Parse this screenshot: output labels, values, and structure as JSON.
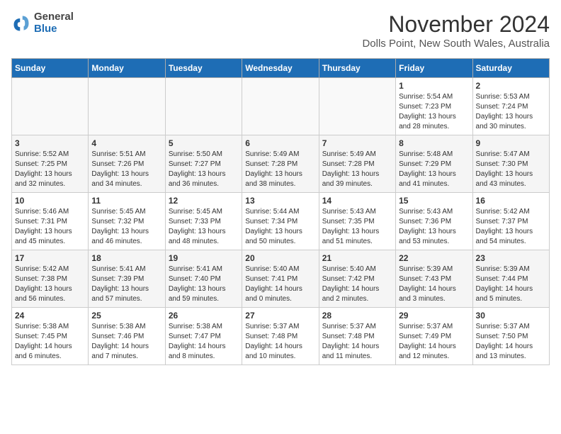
{
  "header": {
    "logo": {
      "line1": "General",
      "line2": "Blue"
    },
    "title": "November 2024",
    "subtitle": "Dolls Point, New South Wales, Australia"
  },
  "weekdays": [
    "Sunday",
    "Monday",
    "Tuesday",
    "Wednesday",
    "Thursday",
    "Friday",
    "Saturday"
  ],
  "weeks": [
    [
      {
        "day": "",
        "info": ""
      },
      {
        "day": "",
        "info": ""
      },
      {
        "day": "",
        "info": ""
      },
      {
        "day": "",
        "info": ""
      },
      {
        "day": "",
        "info": ""
      },
      {
        "day": "1",
        "info": "Sunrise: 5:54 AM\nSunset: 7:23 PM\nDaylight: 13 hours and 28 minutes."
      },
      {
        "day": "2",
        "info": "Sunrise: 5:53 AM\nSunset: 7:24 PM\nDaylight: 13 hours and 30 minutes."
      }
    ],
    [
      {
        "day": "3",
        "info": "Sunrise: 5:52 AM\nSunset: 7:25 PM\nDaylight: 13 hours and 32 minutes."
      },
      {
        "day": "4",
        "info": "Sunrise: 5:51 AM\nSunset: 7:26 PM\nDaylight: 13 hours and 34 minutes."
      },
      {
        "day": "5",
        "info": "Sunrise: 5:50 AM\nSunset: 7:27 PM\nDaylight: 13 hours and 36 minutes."
      },
      {
        "day": "6",
        "info": "Sunrise: 5:49 AM\nSunset: 7:28 PM\nDaylight: 13 hours and 38 minutes."
      },
      {
        "day": "7",
        "info": "Sunrise: 5:49 AM\nSunset: 7:28 PM\nDaylight: 13 hours and 39 minutes."
      },
      {
        "day": "8",
        "info": "Sunrise: 5:48 AM\nSunset: 7:29 PM\nDaylight: 13 hours and 41 minutes."
      },
      {
        "day": "9",
        "info": "Sunrise: 5:47 AM\nSunset: 7:30 PM\nDaylight: 13 hours and 43 minutes."
      }
    ],
    [
      {
        "day": "10",
        "info": "Sunrise: 5:46 AM\nSunset: 7:31 PM\nDaylight: 13 hours and 45 minutes."
      },
      {
        "day": "11",
        "info": "Sunrise: 5:45 AM\nSunset: 7:32 PM\nDaylight: 13 hours and 46 minutes."
      },
      {
        "day": "12",
        "info": "Sunrise: 5:45 AM\nSunset: 7:33 PM\nDaylight: 13 hours and 48 minutes."
      },
      {
        "day": "13",
        "info": "Sunrise: 5:44 AM\nSunset: 7:34 PM\nDaylight: 13 hours and 50 minutes."
      },
      {
        "day": "14",
        "info": "Sunrise: 5:43 AM\nSunset: 7:35 PM\nDaylight: 13 hours and 51 minutes."
      },
      {
        "day": "15",
        "info": "Sunrise: 5:43 AM\nSunset: 7:36 PM\nDaylight: 13 hours and 53 minutes."
      },
      {
        "day": "16",
        "info": "Sunrise: 5:42 AM\nSunset: 7:37 PM\nDaylight: 13 hours and 54 minutes."
      }
    ],
    [
      {
        "day": "17",
        "info": "Sunrise: 5:42 AM\nSunset: 7:38 PM\nDaylight: 13 hours and 56 minutes."
      },
      {
        "day": "18",
        "info": "Sunrise: 5:41 AM\nSunset: 7:39 PM\nDaylight: 13 hours and 57 minutes."
      },
      {
        "day": "19",
        "info": "Sunrise: 5:41 AM\nSunset: 7:40 PM\nDaylight: 13 hours and 59 minutes."
      },
      {
        "day": "20",
        "info": "Sunrise: 5:40 AM\nSunset: 7:41 PM\nDaylight: 14 hours and 0 minutes."
      },
      {
        "day": "21",
        "info": "Sunrise: 5:40 AM\nSunset: 7:42 PM\nDaylight: 14 hours and 2 minutes."
      },
      {
        "day": "22",
        "info": "Sunrise: 5:39 AM\nSunset: 7:43 PM\nDaylight: 14 hours and 3 minutes."
      },
      {
        "day": "23",
        "info": "Sunrise: 5:39 AM\nSunset: 7:44 PM\nDaylight: 14 hours and 5 minutes."
      }
    ],
    [
      {
        "day": "24",
        "info": "Sunrise: 5:38 AM\nSunset: 7:45 PM\nDaylight: 14 hours and 6 minutes."
      },
      {
        "day": "25",
        "info": "Sunrise: 5:38 AM\nSunset: 7:46 PM\nDaylight: 14 hours and 7 minutes."
      },
      {
        "day": "26",
        "info": "Sunrise: 5:38 AM\nSunset: 7:47 PM\nDaylight: 14 hours and 8 minutes."
      },
      {
        "day": "27",
        "info": "Sunrise: 5:37 AM\nSunset: 7:48 PM\nDaylight: 14 hours and 10 minutes."
      },
      {
        "day": "28",
        "info": "Sunrise: 5:37 AM\nSunset: 7:48 PM\nDaylight: 14 hours and 11 minutes."
      },
      {
        "day": "29",
        "info": "Sunrise: 5:37 AM\nSunset: 7:49 PM\nDaylight: 14 hours and 12 minutes."
      },
      {
        "day": "30",
        "info": "Sunrise: 5:37 AM\nSunset: 7:50 PM\nDaylight: 14 hours and 13 minutes."
      }
    ]
  ]
}
